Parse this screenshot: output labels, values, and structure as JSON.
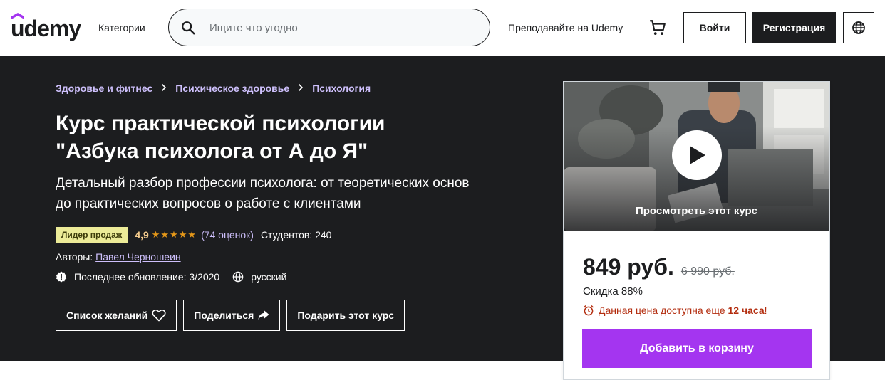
{
  "header": {
    "logo": "udemy",
    "categories_label": "Категории",
    "search_placeholder": "Ищите что угодно",
    "teach_label": "Преподавайте на Udemy",
    "login_label": "Войти",
    "signup_label": "Регистрация"
  },
  "breadcrumbs": [
    "Здоровье и фитнес",
    "Психическое здоровье",
    "Психология"
  ],
  "course": {
    "title_line1": "Курс практической психологии",
    "title_line2": "\"Азбука психолога от А до Я\"",
    "subtitle_line1": "Детальный разбор профессии психолога: от теоретических основ",
    "subtitle_line2": "до практических вопросов о работе с клиентами",
    "badge": "Лидер продаж",
    "rating": "4,9",
    "stars": "★★★★★",
    "rating_count": "(74 оценок)",
    "students": "Студентов: 240",
    "authors_label": "Авторы:",
    "author_name": "Павел Черношеин",
    "updated": "Последнее обновление: 3/2020",
    "language": "русский"
  },
  "actions": {
    "wishlist": "Список желаний",
    "share": "Поделиться",
    "gift": "Подарить этот курс"
  },
  "card": {
    "preview_label": "Просмотреть этот курс",
    "price": "849 руб.",
    "old_price": "6 990 руб.",
    "discount": "Скидка 88%",
    "timer_text": "Данная цена доступна еще",
    "timer_hours": "12 часа",
    "timer_end": "!",
    "add_to_cart": "Добавить в корзину"
  },
  "colors": {
    "brand": "#a435f0",
    "dark": "#1c1d1f",
    "link": "#cec0fc",
    "badge_bg": "#eceb98",
    "star": "#e59819",
    "alert": "#b32d0f"
  }
}
